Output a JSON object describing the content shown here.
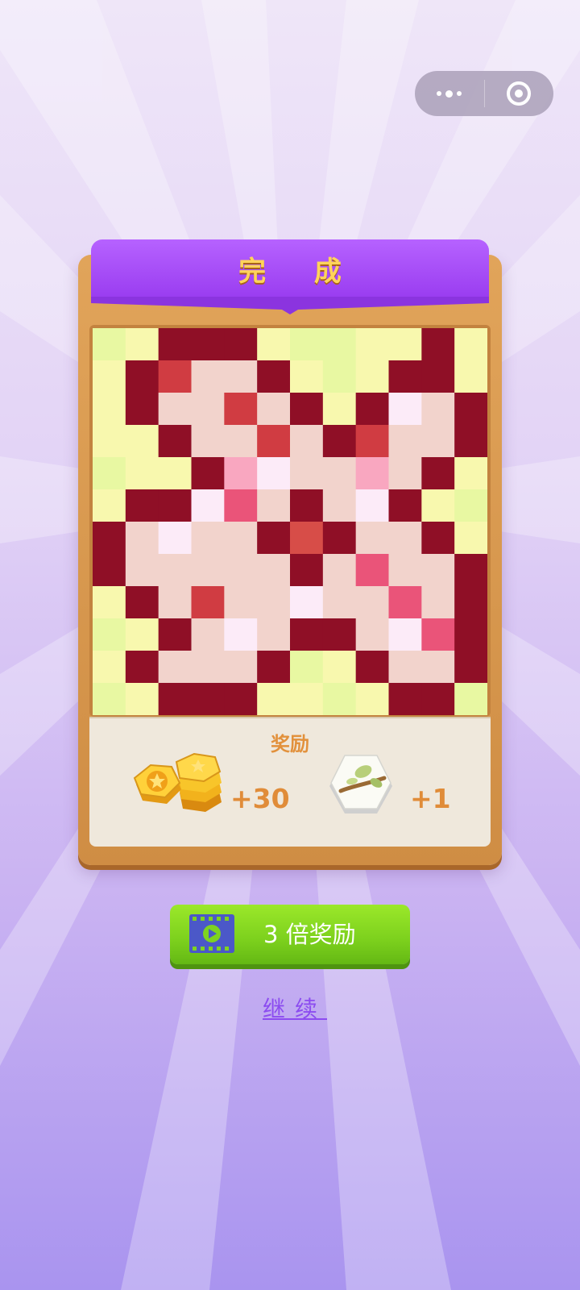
{
  "capsule": {
    "more_icon": "more-dots-icon",
    "close_icon": "target-circle-icon"
  },
  "card": {
    "title": "完 成",
    "grid": {
      "rows": 12,
      "cols": 12,
      "palette": {
        "a": "#f8f8ae",
        "g": "#e8f8a2",
        "m": "#8f0f26",
        "r": "#d03c42",
        "p": "#f2d3cc",
        "w": "#fcebf8",
        "k": "#f9a7c0",
        "h": "#ea5479",
        "o": "#d74d48"
      },
      "cells": [
        "gammmaggaama",
        "amrppmagamma",
        "ampnrpmamwpm",
        "aampprpmrppm",
        "gaamkwpnkpma",
        "ammwhpmpwmag",
        "mpwppmomppma",
        "mpppnpmphppm",
        "amprppwpphpm",
        "gampwpmmpwhm",
        "ampppmgampp m",
        "gammmaagammg"
      ]
    },
    "reward": {
      "title": "奖励",
      "coin_icon": "gold-coins-icon",
      "coin_amount": "+30",
      "tile_icon": "hexagon-tile-icon",
      "tile_amount": "+1"
    }
  },
  "buttons": {
    "triple": {
      "icon": "video-play-icon",
      "label": "3 倍奖励"
    },
    "continue": {
      "label": "继续"
    }
  }
}
